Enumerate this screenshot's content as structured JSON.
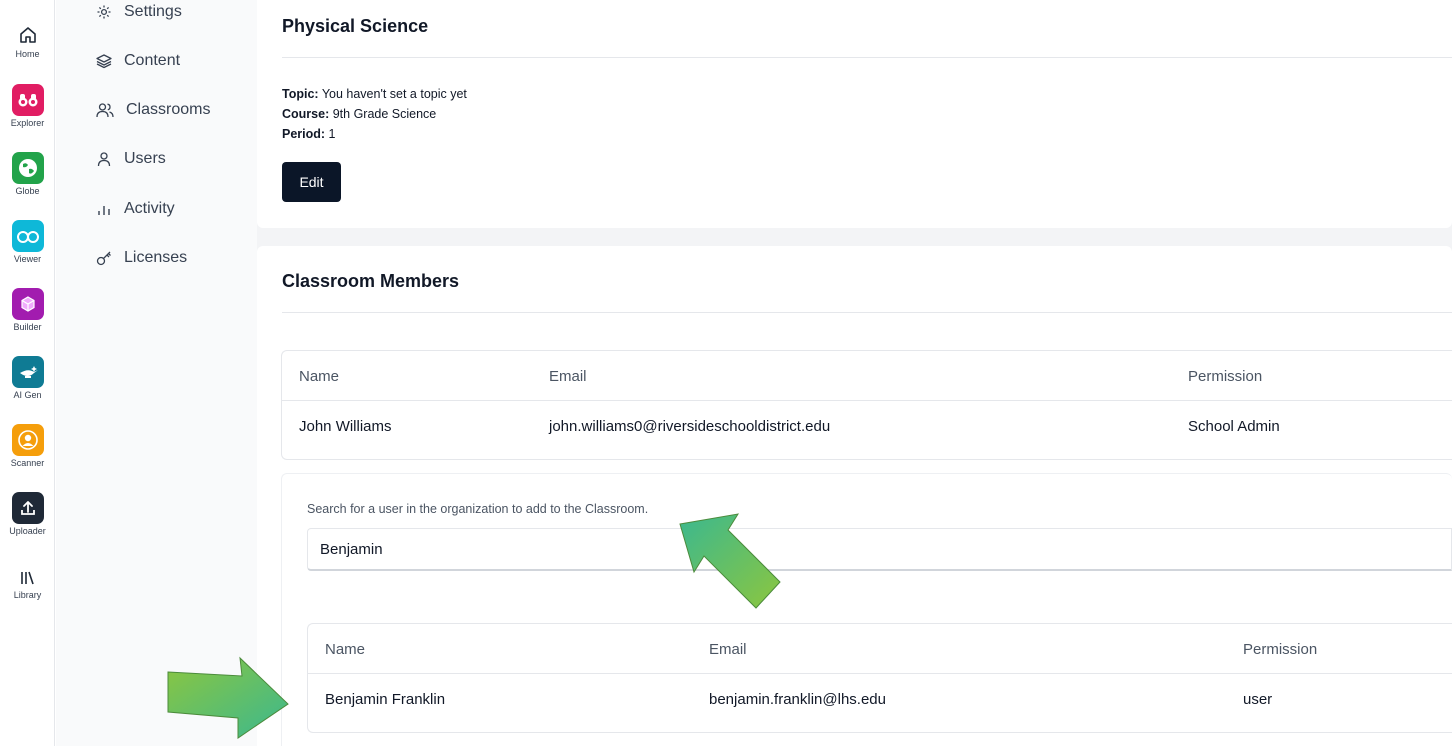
{
  "app_rail": {
    "items": [
      {
        "label": "Home",
        "icon": "home-icon"
      },
      {
        "label": "Explorer",
        "icon": "binoculars-icon",
        "color": "#e11d63"
      },
      {
        "label": "Globe",
        "icon": "globe-icon",
        "color": "#22a34a"
      },
      {
        "label": "Viewer",
        "icon": "glasses-icon",
        "color": "#0eb8d8"
      },
      {
        "label": "Builder",
        "icon": "cube-icon",
        "color": "#a21caf"
      },
      {
        "label": "AI Gen",
        "icon": "genie-lamp-icon",
        "color": "#0f7b94"
      },
      {
        "label": "Scanner",
        "icon": "scanner-icon",
        "color": "#f59e0b"
      },
      {
        "label": "Uploader",
        "icon": "upload-icon",
        "color": "#1f2937"
      },
      {
        "label": "Library",
        "icon": "library-icon"
      }
    ]
  },
  "admin_nav": {
    "items": [
      {
        "label": "Settings",
        "icon": "gear-icon"
      },
      {
        "label": "Content",
        "icon": "layers-icon"
      },
      {
        "label": "Classrooms",
        "icon": "users-group-icon"
      },
      {
        "label": "Users",
        "icon": "user-icon"
      },
      {
        "label": "Activity",
        "icon": "bar-chart-icon"
      },
      {
        "label": "Licenses",
        "icon": "key-icon"
      }
    ]
  },
  "classroom": {
    "title": "Physical Science",
    "topic_label": "Topic:",
    "topic_value": "You haven't set a topic yet",
    "course_label": "Course:",
    "course_value": "9th Grade Science",
    "period_label": "Period:",
    "period_value": "1",
    "edit_label": "Edit"
  },
  "members": {
    "title": "Classroom Members",
    "columns": [
      "Name",
      "Email",
      "Permission"
    ],
    "rows": [
      {
        "name": "John Williams",
        "email": "john.williams0@riversideschooldistrict.edu",
        "permission": "School Admin"
      }
    ]
  },
  "add_member": {
    "search_label": "Search for a user in the organization to add to the Classroom.",
    "search_value": "Benjamin",
    "columns": [
      "Name",
      "Email",
      "Permission"
    ],
    "results": [
      {
        "name": "Benjamin Franklin",
        "email": "benjamin.franklin@lhs.edu",
        "permission": "user"
      }
    ]
  },
  "colors": {
    "primary_button": "#0b1628",
    "arrow_gradient_start": "#3bb88f",
    "arrow_gradient_end": "#8cc63f"
  }
}
